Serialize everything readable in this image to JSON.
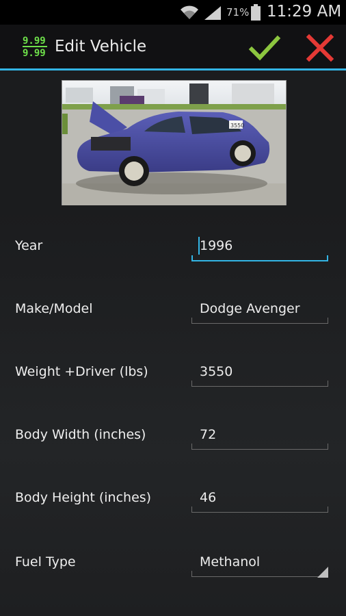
{
  "status_bar": {
    "battery_percent": "71%",
    "time": "11:29 AM"
  },
  "action_bar": {
    "app_icon_text_top": "9.99",
    "app_icon_text_bottom": "9.99",
    "title": "Edit Vehicle",
    "save_icon": "checkmark-icon",
    "cancel_icon": "close-icon"
  },
  "vehicle_photo": {
    "plate_text": "3550"
  },
  "fields": [
    {
      "label": "Year",
      "value": "1996"
    },
    {
      "label": "Make/Model",
      "value": "Dodge Avenger"
    },
    {
      "label": "Weight +Driver (lbs)",
      "value": "3550"
    },
    {
      "label": "Body Width (inches)",
      "value": "72"
    },
    {
      "label": "Body Height (inches)",
      "value": "46"
    },
    {
      "label": "Fuel Type",
      "value": "Methanol"
    }
  ],
  "colors": {
    "accent": "#33b5e5",
    "save": "#8cc63f",
    "cancel": "#e53935",
    "app_icon": "#6ee04a"
  }
}
